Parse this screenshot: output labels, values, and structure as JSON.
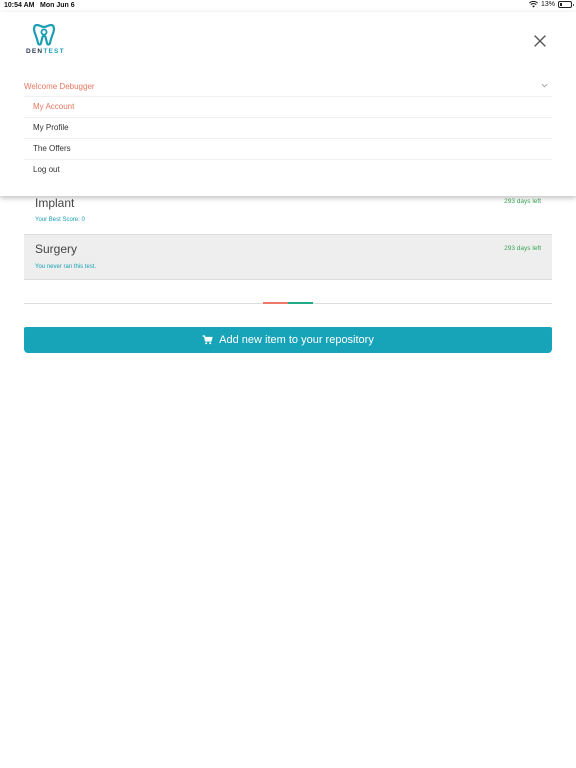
{
  "status_bar": {
    "time": "10:54 AM",
    "date": "Mon Jun 6",
    "battery": "13%"
  },
  "logo": {
    "text_dark": "DEN",
    "text_accent": "TEST"
  },
  "menu": {
    "header": "Welcome Debugger",
    "items": [
      {
        "label": "My Account",
        "active": true
      },
      {
        "label": "My Profile",
        "active": false
      },
      {
        "label": "The Offers",
        "active": false
      },
      {
        "label": "Log out",
        "active": false
      }
    ]
  },
  "tests": [
    {
      "title": "Implant",
      "days_left": "293 days left",
      "subtitle": "Your Best Score: 0"
    },
    {
      "title": "Surgery",
      "days_left": "293 days left",
      "subtitle": "You never ran this test."
    }
  ],
  "add_button": {
    "label": "Add new item to your repository"
  },
  "colors": {
    "accent": "#17a3b8",
    "menu_active": "#e8775f",
    "days_left": "#3aa655"
  },
  "icons": [
    "wifi-icon",
    "battery-icon",
    "tooth-logo-icon",
    "close-icon",
    "chevron-down-icon",
    "cart-icon"
  ]
}
